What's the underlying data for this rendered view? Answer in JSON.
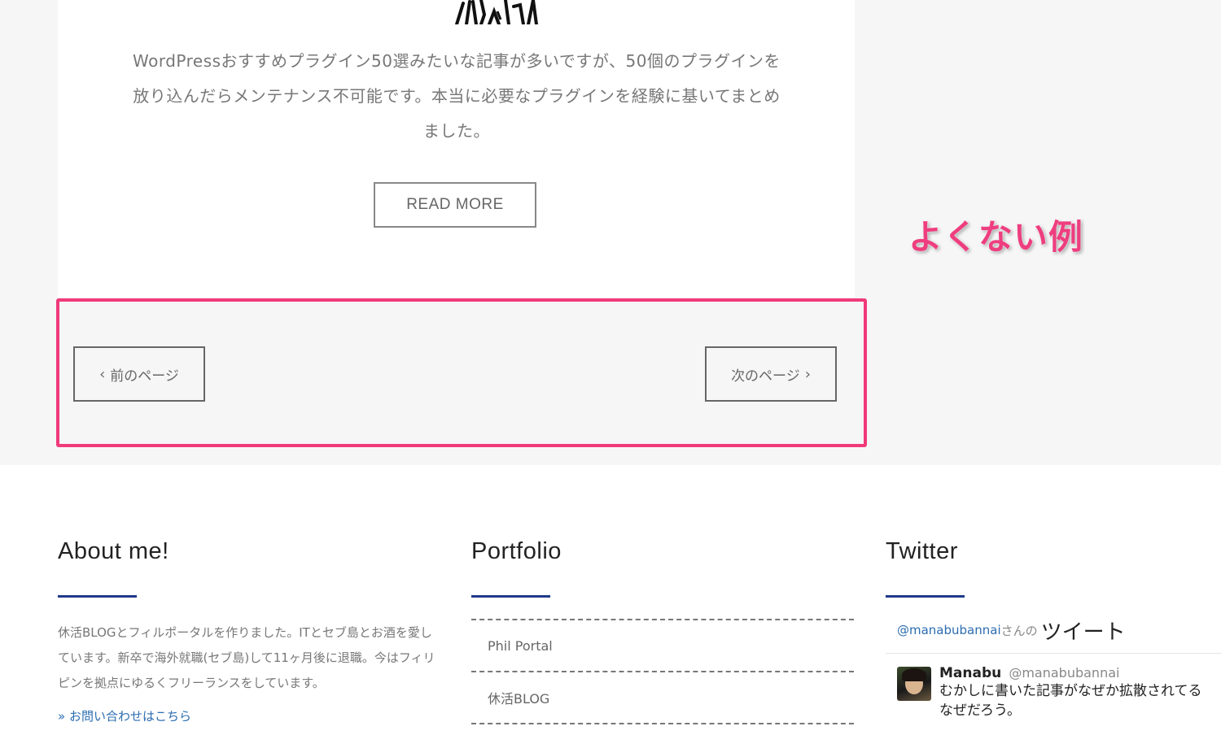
{
  "post": {
    "excerpt_line1": "WordPressおすすめプラグイン50選みたいな記事が多いですが、50個のプラグインを",
    "excerpt_line2": "放り込んだらメンテナンス不可能です。本当に必要なプラグインを経験に基いてまとめ",
    "excerpt_line3": "ました。",
    "read_more_label": "READ MORE"
  },
  "annotation": {
    "bad_example_label": "よくない例",
    "highlight_color": "#f03a7a"
  },
  "pagination": {
    "prev_label": "前のページ",
    "next_label": "次のページ",
    "prev_icon": "chevron-left-icon",
    "next_icon": "chevron-right-icon"
  },
  "footer": {
    "about": {
      "title": "About me!",
      "text": "休活BLOGとフィルポータルを作りました。ITとセブ島とお酒を愛しています。新卒で海外就職(セブ島)して11ヶ月後に退職。今はフィリピンを拠点にゆるくフリーランスをしています。",
      "link_label": "» お問い合わせはこちら"
    },
    "portfolio": {
      "title": "Portfolio",
      "items": [
        "Phil Portal",
        "休活BLOG"
      ]
    },
    "twitter": {
      "title": "Twitter",
      "header_handle": "@manabubannai",
      "header_san": "さんの",
      "header_tweet": "ツイート",
      "tweet": {
        "name": "Manabu",
        "handle": "@manabubannai",
        "text_line1": "むかしに書いた記事がなぜか拡散されてる",
        "text_line2": "なぜだろう。"
      }
    }
  },
  "colors": {
    "accent_rule": "#203a8a",
    "link": "#2b6cb0",
    "annotation_pink": "#ee3e7f"
  }
}
